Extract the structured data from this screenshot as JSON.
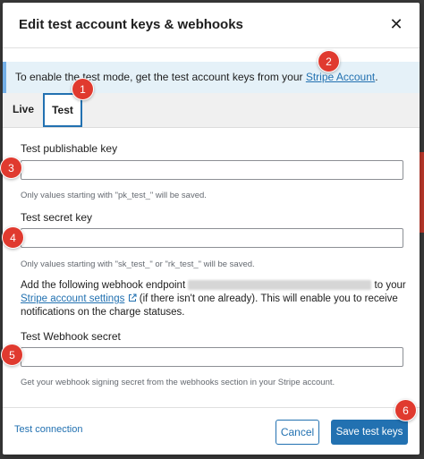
{
  "modal": {
    "title": "Edit test account keys & webhooks",
    "close_icon": "close-icon"
  },
  "notice": {
    "text_before": "To enable the test mode, get the test account keys from your ",
    "link": "Stripe Account",
    "text_after": "."
  },
  "tabs": [
    {
      "label": "Live",
      "active": false
    },
    {
      "label": "Test",
      "active": true
    }
  ],
  "fields": {
    "publishable": {
      "label": "Test publishable key",
      "value": "",
      "help": "Only values starting with \"pk_test_\" will be saved."
    },
    "secret": {
      "label": "Test secret key",
      "value": "",
      "help": "Only values starting with \"sk_test_\" or \"rk_test_\" will be saved."
    },
    "webhook_secret": {
      "label": "Test Webhook secret",
      "value": "",
      "help": "Get your webhook signing secret from the webhooks section in your Stripe account."
    }
  },
  "webhook_info": {
    "text_before": "Add the following webhook endpoint",
    "text_to": " to your",
    "link": "Stripe account settings",
    "text_after": " (if there isn't one already). This will enable you to receive notifications on the charge statuses."
  },
  "footer": {
    "test_connection": "Test connection",
    "cancel": "Cancel",
    "save": "Save test keys"
  },
  "badges": [
    "1",
    "2",
    "3",
    "4",
    "5",
    "6"
  ],
  "colors": {
    "accent": "#2271b1",
    "badge": "#e03a2f",
    "notice_bg": "#e5f1f8"
  }
}
